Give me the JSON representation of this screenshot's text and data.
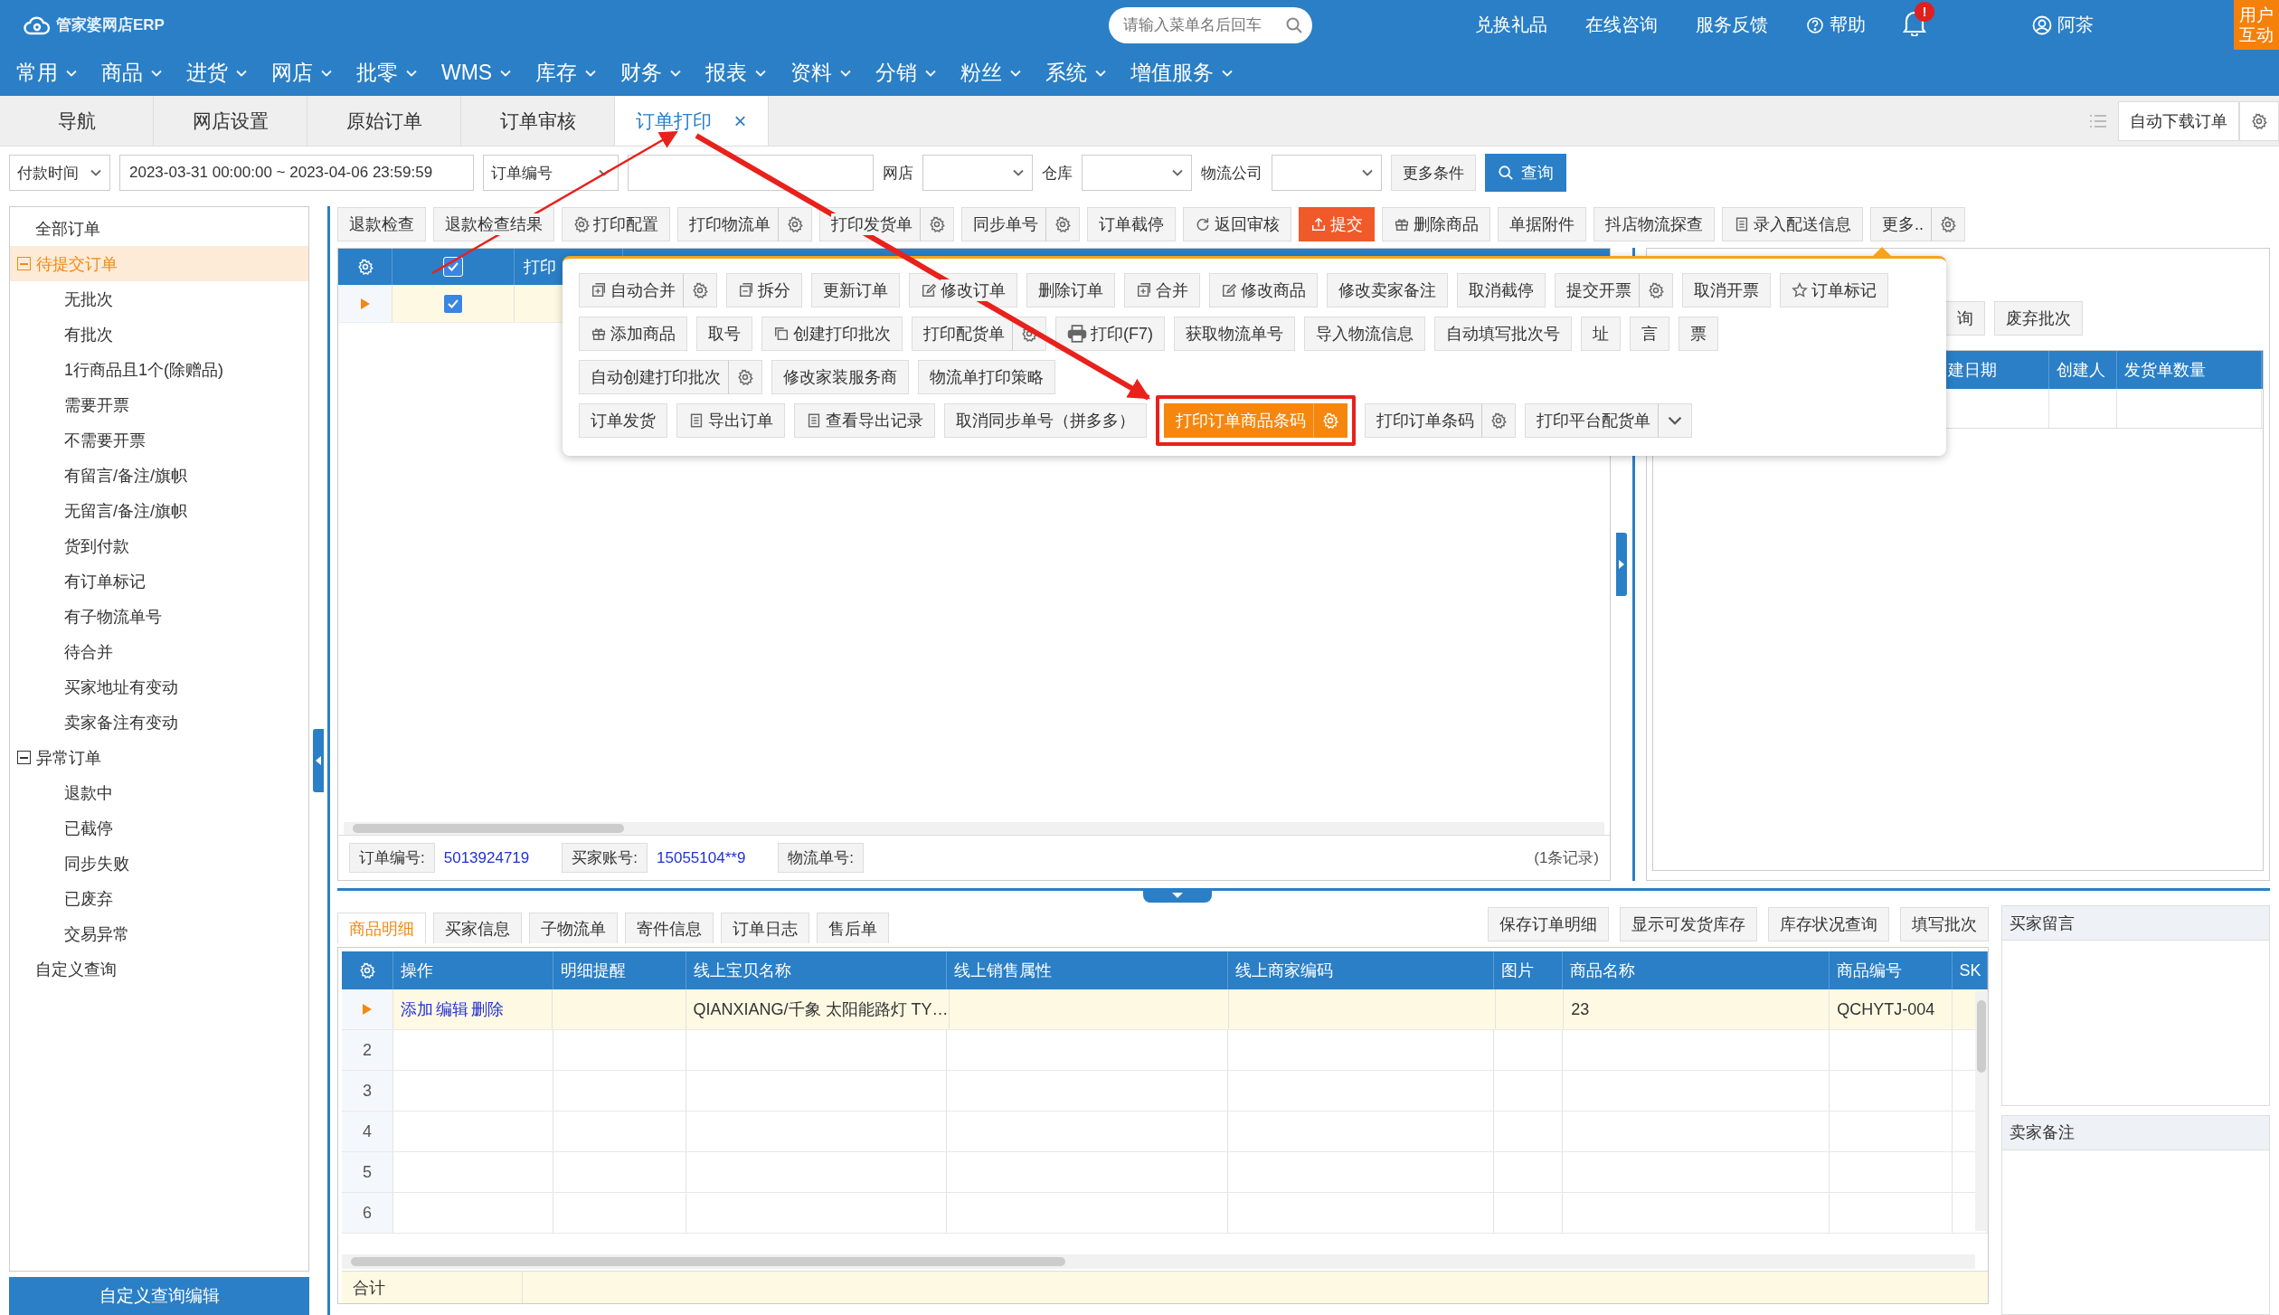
{
  "header": {
    "logo": "管家婆网店ERP",
    "search": {
      "placeholder": "请输入菜单名后回车"
    },
    "links": [
      {
        "label": "兑换礼品"
      },
      {
        "label": "在线咨询"
      },
      {
        "label": "服务反馈"
      },
      {
        "label": "帮助",
        "kind": "help"
      }
    ],
    "notification_badge": "!",
    "user": "阿茶",
    "corner_button": "用户互动"
  },
  "menu": [
    "常用",
    "商品",
    "进货",
    "网店",
    "批零",
    "WMS",
    "库存",
    "财务",
    "报表",
    "资料",
    "分销",
    "粉丝",
    "系统",
    "增值服务"
  ],
  "tabs": [
    {
      "label": "导航",
      "selected": false
    },
    {
      "label": "网店设置",
      "selected": false
    },
    {
      "label": "原始订单",
      "selected": false
    },
    {
      "label": "订单审核",
      "selected": false
    },
    {
      "label": "订单打印",
      "selected": true,
      "close": "×"
    }
  ],
  "tab_tools": {
    "button": "自动下载订单"
  },
  "filters": [
    {
      "kind": "select",
      "value": "付款时间"
    },
    {
      "kind": "text",
      "value": "2023-03-31 00:00:00 ~ 2023-04-06 23:59:59"
    },
    {
      "kind": "select",
      "value": "订单编号"
    },
    {
      "kind": "text"
    },
    {
      "kind": "select",
      "label": "网店"
    },
    {
      "kind": "select",
      "label": "仓库"
    },
    {
      "kind": "select",
      "label": "物流公司"
    },
    {
      "kind": "button",
      "label": "更多条件"
    },
    {
      "kind": "primary",
      "label": "查询"
    }
  ],
  "sidebar": {
    "items": [
      {
        "label": "全部订单",
        "selected": false
      },
      {
        "label": "待提交订单",
        "selected": true,
        "expanded": true,
        "children": [
          {
            "label": "无批次",
            "selected": false
          },
          {
            "label": "有批次",
            "selected": false
          },
          {
            "label": "1行商品且1个(除赠品)",
            "selected": false
          },
          {
            "label": "需要开票",
            "selected": false
          },
          {
            "label": "不需要开票",
            "selected": false
          },
          {
            "label": "有留言/备注/旗帜",
            "selected": false
          },
          {
            "label": "无留言/备注/旗帜",
            "selected": false
          },
          {
            "label": "货到付款",
            "selected": false
          },
          {
            "label": "有订单标记",
            "selected": false
          },
          {
            "label": "有子物流单号",
            "selected": false
          },
          {
            "label": "待合并",
            "selected": false
          },
          {
            "label": "买家地址有变动",
            "selected": false
          },
          {
            "label": "卖家备注有变动",
            "selected": false
          }
        ]
      },
      {
        "label": "异常订单",
        "selected": false,
        "expanded": true,
        "children": [
          {
            "label": "退款中",
            "selected": false
          },
          {
            "label": "已截停",
            "selected": false
          },
          {
            "label": "同步失败",
            "selected": false
          },
          {
            "label": "已废弃",
            "selected": false
          },
          {
            "label": "交易异常",
            "selected": false
          }
        ]
      },
      {
        "label": "自定义查询",
        "selected": false
      }
    ],
    "footer_button": "自定义查询编辑"
  },
  "toolbar": [
    {
      "label": "退款检查"
    },
    {
      "label": "退款检查结果"
    },
    {
      "label": "打印配置",
      "kind": "config"
    },
    {
      "label": "打印物流单",
      "gear": true
    },
    {
      "label": "打印发货单",
      "gear": true
    },
    {
      "label": "同步单号",
      "gear": true
    },
    {
      "label": "订单截停"
    },
    {
      "label": "返回审核",
      "kind": "refresh"
    },
    {
      "label": "提交",
      "kind": "submit"
    },
    {
      "label": "删除商品",
      "kind": "gift"
    },
    {
      "label": "单据附件"
    },
    {
      "label": "抖店物流探查"
    },
    {
      "label": "录入配送信息",
      "kind": "document"
    },
    {
      "label": "更多..",
      "gear": true
    }
  ],
  "order_grid": {
    "header_checked": true,
    "columns": [
      "打印"
    ],
    "rows": [
      {
        "current": true,
        "checked": true
      }
    ],
    "info": [
      {
        "label": "订单编号:",
        "value": "5013924719"
      },
      {
        "label": "买家账号:",
        "value": "15055104**9"
      },
      {
        "label": "物流单号:"
      }
    ],
    "record_count": "(1条记录)"
  },
  "batch_panel": {
    "buttons": [
      "询",
      "废弃批次"
    ],
    "columns": [
      "建日期",
      "创建人",
      "发货单数量"
    ]
  },
  "more_menu": {
    "lines": [
      [
        {
          "label": "自动合并",
          "kind": "merge",
          "gear": true
        },
        {
          "label": "拆分",
          "kind": "split"
        },
        {
          "label": "更新订单"
        },
        {
          "label": "修改订单",
          "kind": "edit"
        },
        {
          "label": "删除订单"
        },
        {
          "label": "合并",
          "kind": "merge"
        },
        {
          "label": "修改商品",
          "kind": "edit"
        },
        {
          "label": "修改卖家备注"
        },
        {
          "label": "取消截停"
        },
        {
          "label": "提交开票",
          "gear": true
        },
        {
          "label": "取消开票"
        },
        {
          "label": "订单标记",
          "kind": "mark"
        }
      ],
      [
        {
          "label": "添加商品",
          "kind": "gift"
        },
        {
          "label": "取号"
        },
        {
          "label": "创建打印批次",
          "kind": "copy"
        },
        {
          "label": "打印配货单",
          "gear": true
        },
        {
          "label": "打印(F7)",
          "kind": "print"
        },
        {
          "label": "获取物流单号"
        },
        {
          "label": "导入物流信息"
        },
        {
          "label": "自动填写批次号"
        },
        {
          "label": "址"
        },
        {
          "label": "言"
        },
        {
          "label": "票"
        }
      ],
      [
        {
          "label": "自动创建打印批次",
          "gear": true
        },
        {
          "label": "修改家装服务商"
        },
        {
          "label": "物流单打印策略"
        }
      ],
      [
        {
          "label": "订单发货"
        },
        {
          "label": "导出订单",
          "kind": "document"
        },
        {
          "label": "查看导出记录",
          "kind": "document"
        },
        {
          "label": "取消同步单号（拼多多）"
        },
        {
          "label": "打印订单商品条码",
          "gear": true,
          "highlighted": true
        },
        {
          "label": "打印订单条码",
          "gear": true
        },
        {
          "label": "打印平台配货单",
          "dropdown": true
        }
      ]
    ]
  },
  "detail": {
    "tabs": [
      {
        "label": "商品明细",
        "selected": true
      },
      {
        "label": "买家信息",
        "selected": false
      },
      {
        "label": "子物流单",
        "selected": false
      },
      {
        "label": "寄件信息",
        "selected": false
      },
      {
        "label": "订单日志",
        "selected": false
      },
      {
        "label": "售后单",
        "selected": false
      }
    ],
    "buttons": [
      "保存订单明细",
      "显示可发货库存",
      "库存状况查询",
      "填写批次"
    ],
    "columns": [
      "操作",
      "明细提醒",
      "线上宝贝名称",
      "线上销售属性",
      "线上商家编码",
      "图片",
      "商品名称",
      "商品编号",
      "SK"
    ],
    "rows": [
      {
        "current": true,
        "actions": [
          "添加",
          "编辑",
          "删除"
        ],
        "online_name": "QIANXIANG/千象 太阳能路灯 TY…",
        "product_name": "23",
        "product_code": "QCHYTJ-004"
      },
      {
        "current": false,
        "number": "2"
      },
      {
        "current": false,
        "number": "3"
      },
      {
        "current": false,
        "number": "4"
      },
      {
        "current": false,
        "number": "5"
      },
      {
        "current": false,
        "number": "6"
      }
    ],
    "footer": "合计"
  },
  "notes": [
    {
      "title": "买家留言"
    },
    {
      "title": "卖家备注"
    }
  ]
}
